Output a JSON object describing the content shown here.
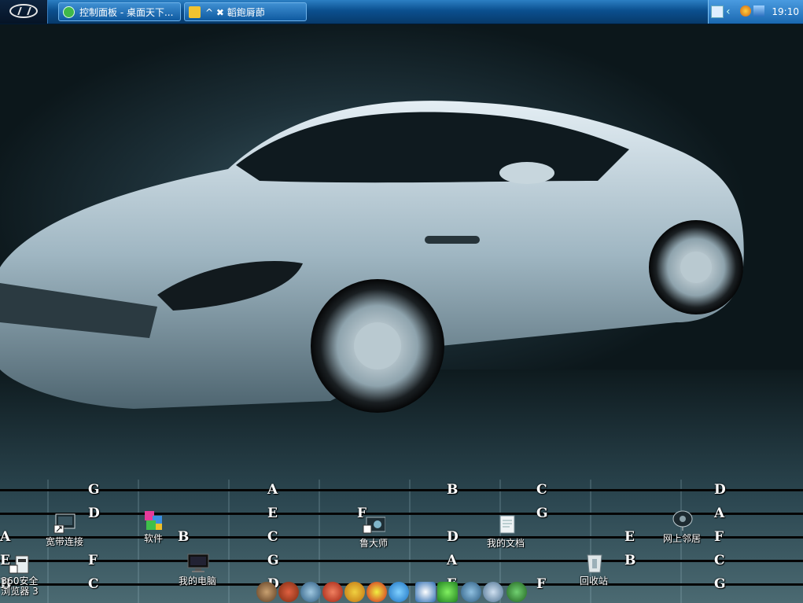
{
  "taskbar": {
    "tasks": [
      {
        "label": "控制面板 - 桌面天下..."
      },
      {
        "label": "^ ✖ 韜鉋脣莭"
      }
    ],
    "clock": "19:10"
  },
  "grid_letters": [
    {
      "text": "G"
    },
    {
      "text": "A"
    },
    {
      "text": "B"
    },
    {
      "text": "C"
    },
    {
      "text": "D"
    },
    {
      "text": "D"
    },
    {
      "text": "E"
    },
    {
      "text": "F"
    },
    {
      "text": "G"
    },
    {
      "text": "A"
    },
    {
      "text": "A"
    },
    {
      "text": "B"
    },
    {
      "text": "C"
    },
    {
      "text": "D"
    },
    {
      "text": "E"
    },
    {
      "text": "F"
    },
    {
      "text": "E"
    },
    {
      "text": "F"
    },
    {
      "text": "G"
    },
    {
      "text": "A"
    },
    {
      "text": "B"
    },
    {
      "text": "C"
    },
    {
      "text": "B"
    },
    {
      "text": "C"
    },
    {
      "text": "D"
    },
    {
      "text": "E"
    },
    {
      "text": "F"
    },
    {
      "text": "G"
    }
  ],
  "desktop_icons": [
    {
      "label": "宽带连接",
      "icon": "network-connection-icon"
    },
    {
      "label": "软件",
      "icon": "software-package-icon"
    },
    {
      "label": "鲁大师",
      "icon": "ludashi-icon"
    },
    {
      "label": "我的文档",
      "icon": "documents-icon"
    },
    {
      "label": "网上邻居",
      "icon": "network-places-icon"
    },
    {
      "label": "360安全",
      "label2": "浏览器 3",
      "icon": "browser-360-icon"
    },
    {
      "label": "我的电脑",
      "icon": "computer-icon"
    },
    {
      "label": "回收站",
      "icon": "recycle-bin-icon"
    }
  ],
  "colors": {
    "taskbar": "#0b4f8e",
    "label": "#ffffff"
  }
}
